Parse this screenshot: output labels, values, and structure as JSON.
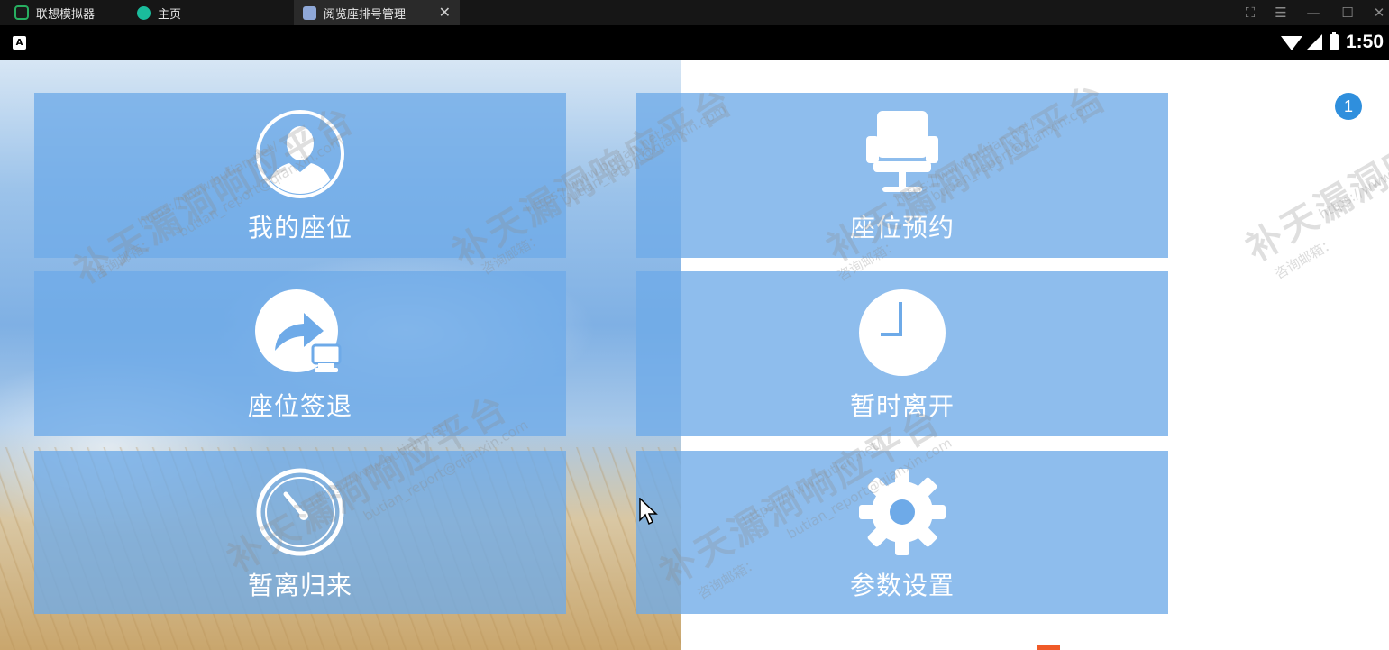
{
  "emulator": {
    "tabs": [
      {
        "label": "联想模拟器"
      },
      {
        "label": "主页"
      },
      {
        "label": "阅览座排号管理"
      }
    ]
  },
  "statusbar": {
    "time": "1:50",
    "app_badge": "A"
  },
  "tiles": [
    {
      "label": "我的座位",
      "icon": "user-avatar-icon"
    },
    {
      "label": "座位预约",
      "icon": "chair-icon"
    },
    {
      "label": "座位签退",
      "icon": "share-arrow-icon"
    },
    {
      "label": "暂时离开",
      "icon": "clock-icon"
    },
    {
      "label": "暂离归来",
      "icon": "timer-icon"
    },
    {
      "label": "参数设置",
      "icon": "gear-icon"
    }
  ],
  "notification_count": "1",
  "watermark": {
    "title": "补天漏洞响应平台",
    "url": "https://www.butian.net/",
    "email_prefix": "咨询邮箱：",
    "email": "butian_report@qianxin.com"
  },
  "colors": {
    "tile": "#6eaae8",
    "badge": "#2f8fdd",
    "titlebar": "#161616"
  }
}
